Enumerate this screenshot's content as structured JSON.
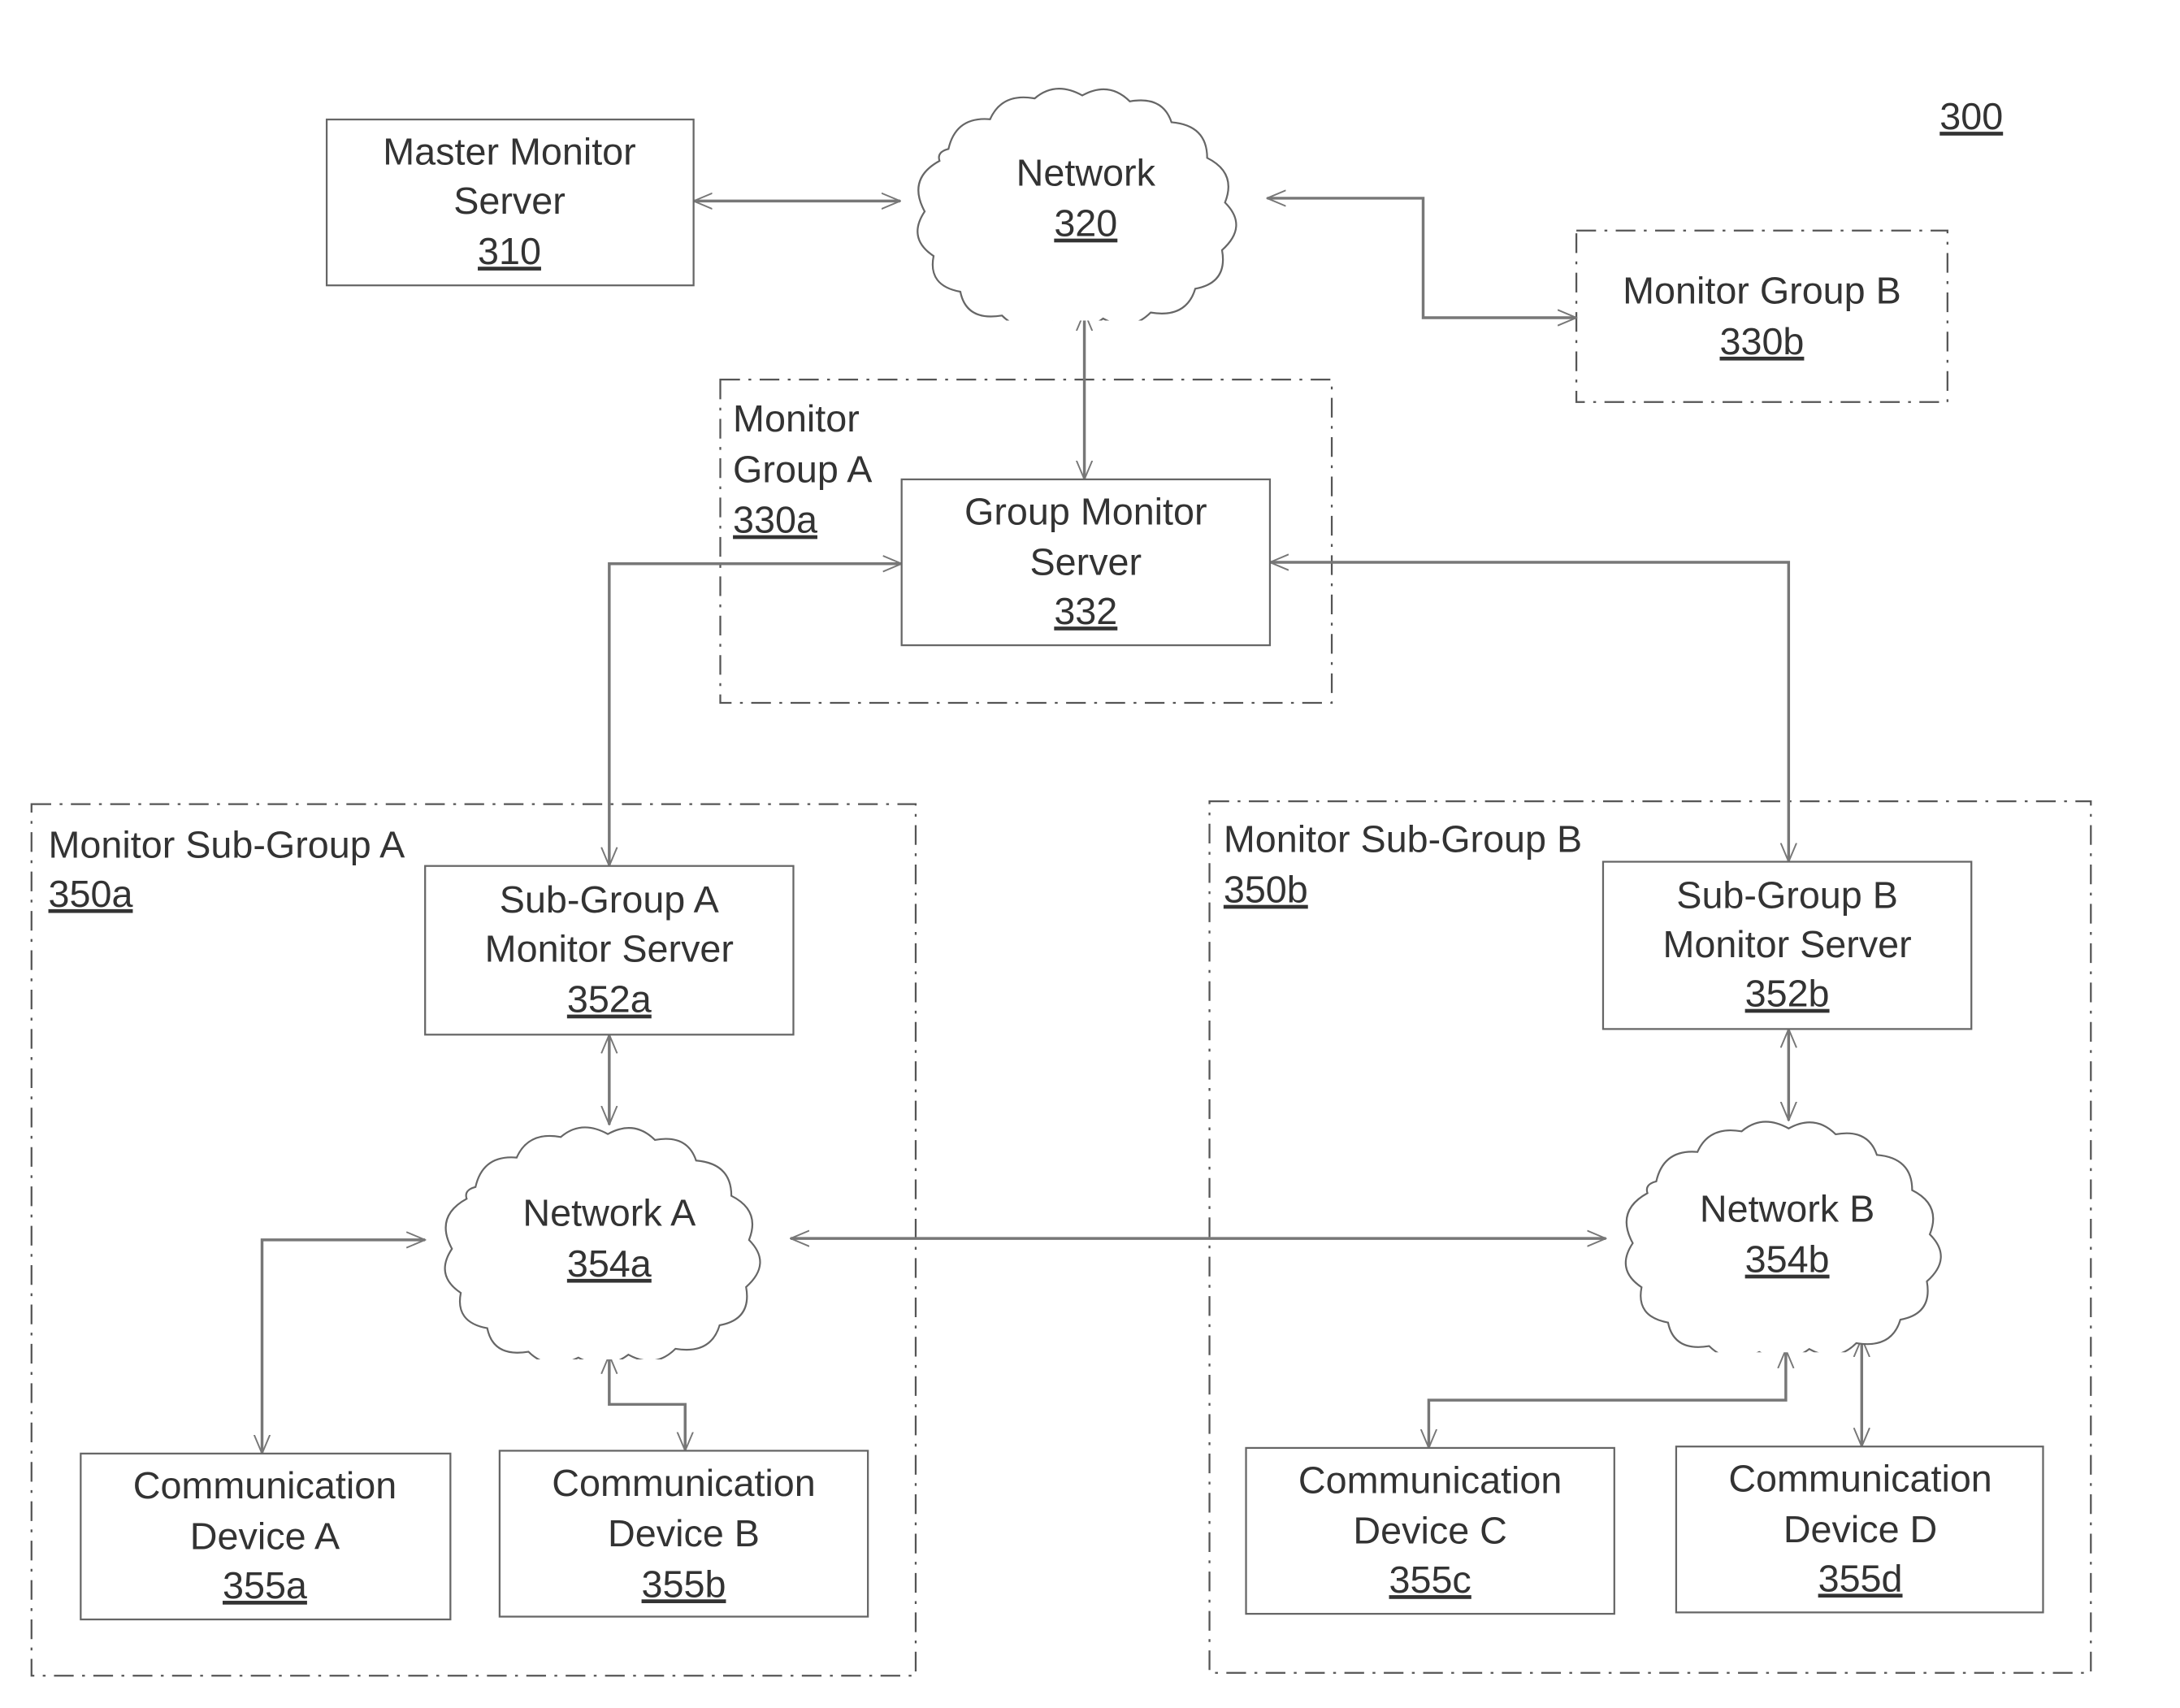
{
  "figure_ref": "300",
  "nodes": {
    "master": {
      "line1": "Master Monitor",
      "line2": "Server",
      "ref": "310"
    },
    "network": {
      "line1": "Network",
      "ref": "320"
    },
    "group_b": {
      "line1": "Monitor Group B",
      "ref": "330b"
    },
    "group_a": {
      "line1": "Monitor",
      "line2": "Group A",
      "ref": "330a"
    },
    "group_server": {
      "line1": "Group Monitor",
      "line2": "Server",
      "ref": "332"
    },
    "subgroup_a": {
      "line1": "Monitor Sub-Group A",
      "ref": "350a"
    },
    "subgroup_b": {
      "line1": "Monitor Sub-Group B",
      "ref": "350b"
    },
    "sub_a_server": {
      "line1": "Sub-Group A",
      "line2": "Monitor Server",
      "ref": "352a"
    },
    "sub_b_server": {
      "line1": "Sub-Group B",
      "line2": "Monitor Server",
      "ref": "352b"
    },
    "network_a": {
      "line1": "Network A",
      "ref": "354a"
    },
    "network_b": {
      "line1": "Network B",
      "ref": "354b"
    },
    "device_a": {
      "line1": "Communication",
      "line2": "Device A",
      "ref": "355a"
    },
    "device_b": {
      "line1": "Communication",
      "line2": "Device B",
      "ref": "355b"
    },
    "device_c": {
      "line1": "Communication",
      "line2": "Device C",
      "ref": "355c"
    },
    "device_d": {
      "line1": "Communication",
      "line2": "Device D",
      "ref": "355d"
    }
  }
}
